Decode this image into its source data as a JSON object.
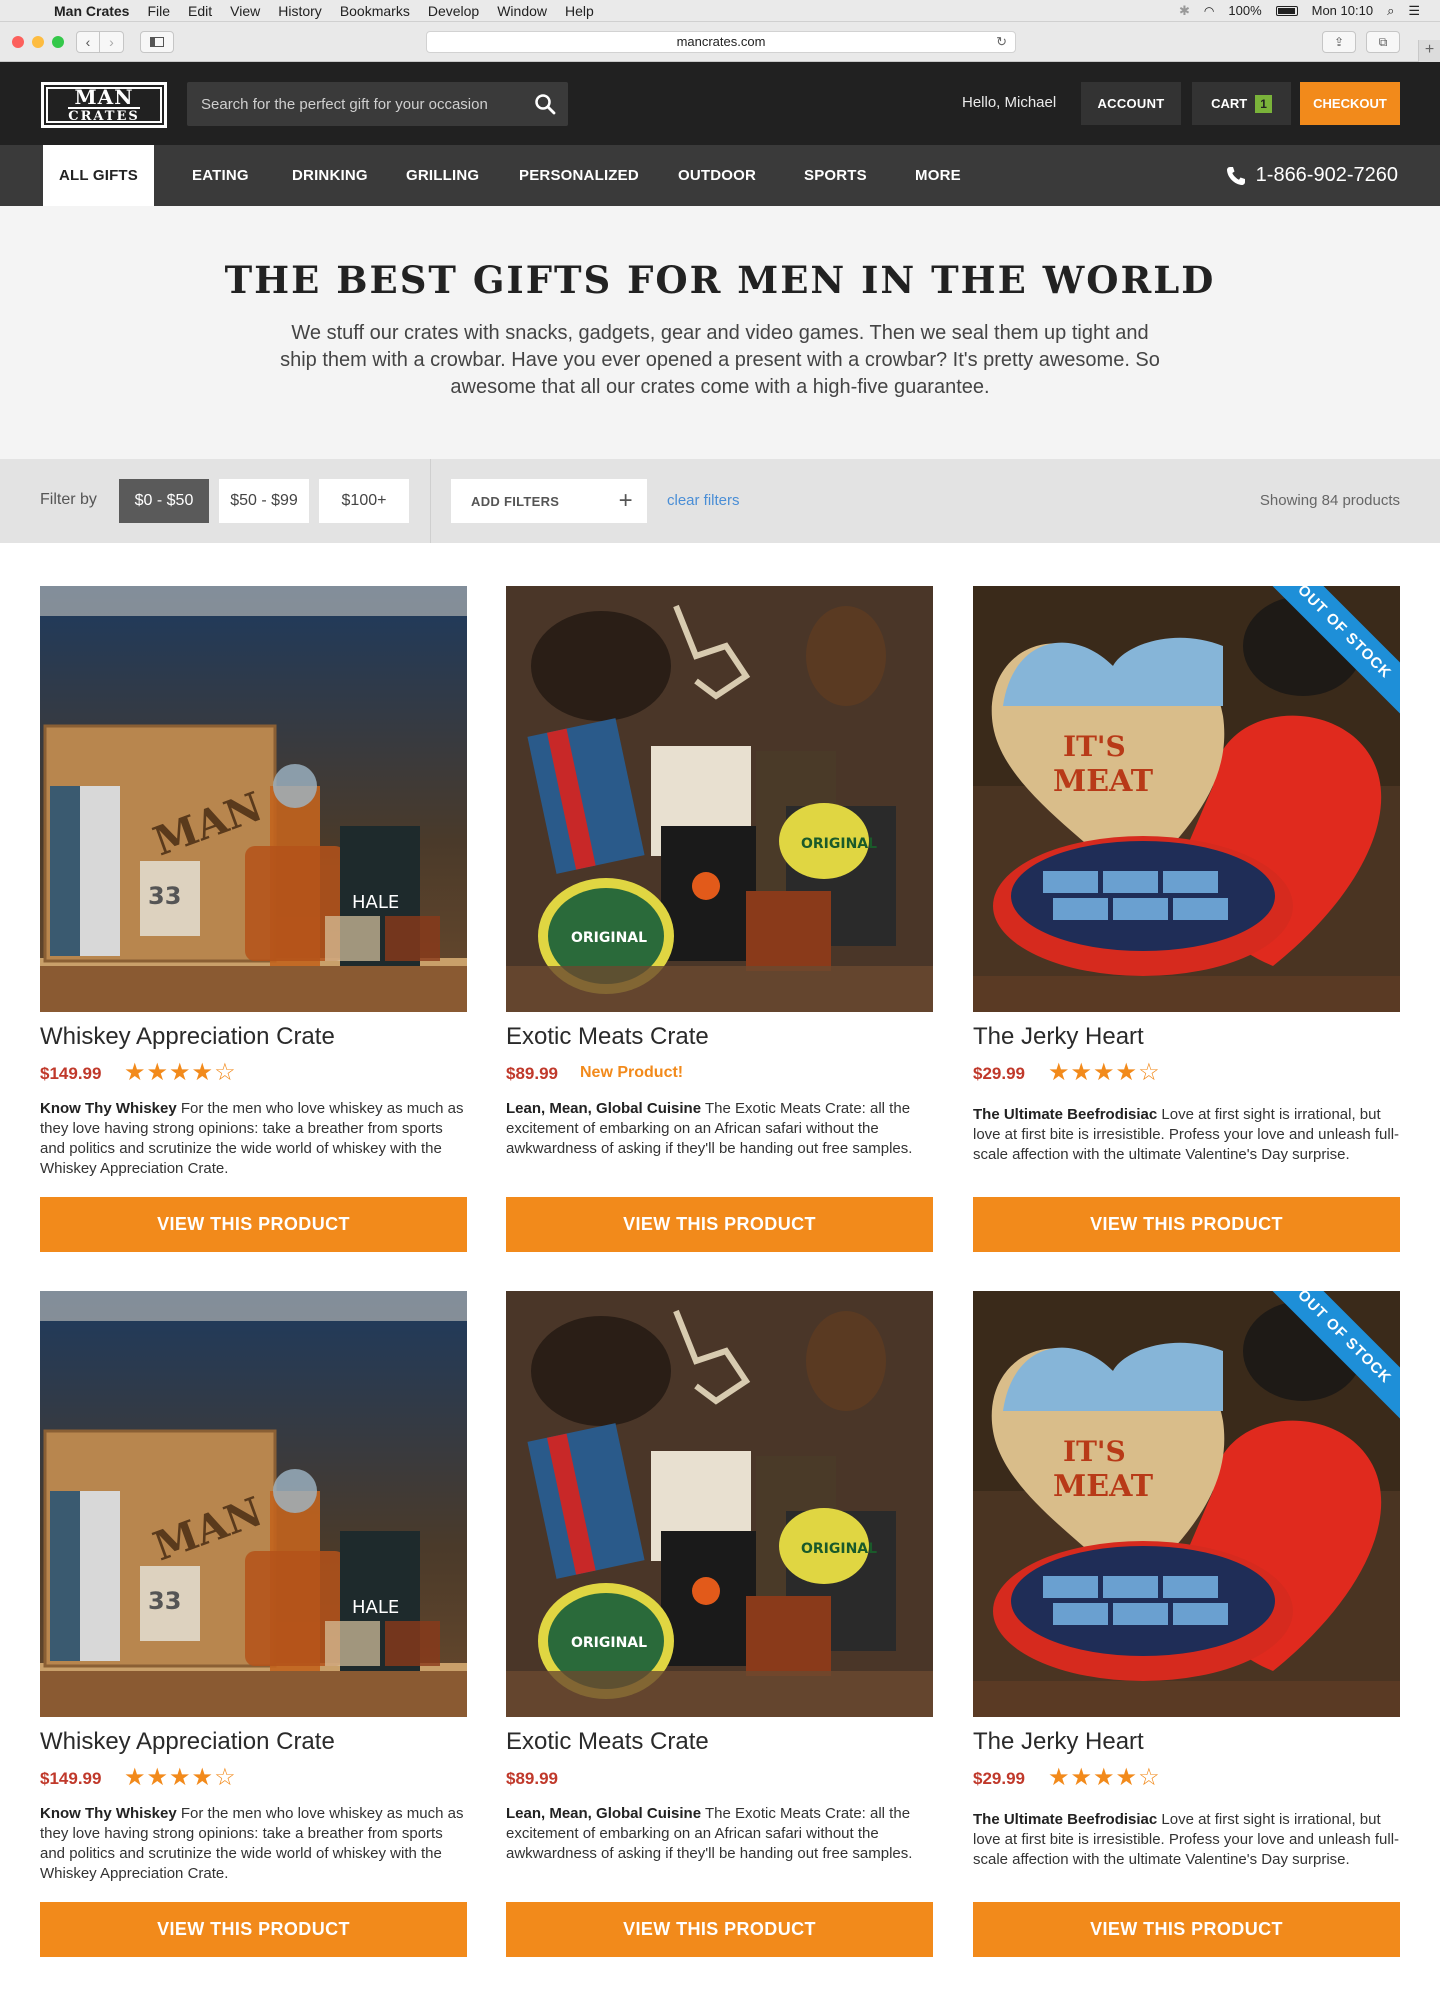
{
  "menubar": {
    "app": "Man Crates",
    "items": [
      "File",
      "Edit",
      "View",
      "History",
      "Bookmarks",
      "Develop",
      "Window",
      "Help"
    ],
    "battery": "100%",
    "clock": "Mon 10:10"
  },
  "browser": {
    "url": "mancrates.com"
  },
  "header": {
    "logo_line1": "MAN",
    "logo_line2": "CRATES",
    "search_placeholder": "Search for the perfect gift for your occasion",
    "greeting": "Hello, Michael",
    "account_label": "ACCOUNT",
    "cart_label": "CART",
    "cart_count": "1",
    "checkout_label": "CHECKOUT"
  },
  "nav": {
    "items": [
      "ALL GIFTS",
      "EATING",
      "DRINKING",
      "GRILLING",
      "PERSONALIZED",
      "OUTDOOR",
      "SPORTS",
      "MORE"
    ],
    "phone": "1-866-902-7260"
  },
  "hero": {
    "title": "THE BEST GIFTS FOR MEN IN THE WORLD",
    "text": "We stuff our crates with snacks, gadgets, gear and video games. Then we seal them up tight and ship them with a crowbar. Have you ever opened a present with a crowbar? It's pretty awesome. So awesome that all our crates come with a high-five guarantee."
  },
  "filters": {
    "label": "Filter by",
    "price_options": [
      "$0 - $50",
      "$50 - $99",
      "$100+"
    ],
    "selected": "$0 - $50",
    "add_filters": "ADD FILTERS",
    "clear": "clear filters",
    "showing": "Showing 84 products"
  },
  "colors": {
    "accent": "#f28a1b",
    "header_bg": "#212121",
    "nav_bg": "#3a3a3a",
    "price": "#c0392b",
    "oos_ribbon": "#1e8fd8"
  },
  "products": [
    {
      "name": "Whiskey Appreciation Crate",
      "price": "$149.99",
      "rating": 4,
      "badge": "",
      "desc_title": "Know Thy Whiskey",
      "desc": "For the men who love whiskey as much as they love having strong opinions: take a breather from sports and politics and scrutinize the wide world of whiskey with the Whiskey Appreciation Crate.",
      "button": "VIEW THIS PRODUCT",
      "out_of_stock": ""
    },
    {
      "name": "Exotic Meats Crate",
      "price": "$89.99",
      "rating": 0,
      "badge": "New Product!",
      "desc_title": "Lean, Mean, Global Cuisine",
      "desc": "The Exotic Meats Crate: all the excitement of embarking on an African safari without the awkwardness of asking if they'll be handing out free samples.",
      "button": "VIEW THIS PRODUCT",
      "out_of_stock": ""
    },
    {
      "name": "The Jerky Heart",
      "price": "$29.99",
      "rating": 4,
      "badge": "",
      "desc_title": "The Ultimate Beefrodisiac",
      "desc": "Love at first sight is irrational, but love at first bite is irresistible. Profess your love and unleash full-scale affection with the ultimate Valentine's Day surprise.",
      "button": "VIEW THIS PRODUCT",
      "out_of_stock": "OUT OF STOCK"
    },
    {
      "name": "Whiskey Appreciation Crate",
      "price": "$149.99",
      "rating": 4,
      "badge": "",
      "desc_title": "Know Thy Whiskey",
      "desc": "For the men who love whiskey as much as they love having strong opinions: take a breather from sports and politics and scrutinize the wide world of whiskey with the Whiskey Appreciation Crate.",
      "button": "VIEW THIS PRODUCT",
      "out_of_stock": ""
    },
    {
      "name": "Exotic Meats Crate",
      "price": "$89.99",
      "rating": 0,
      "badge": "",
      "desc_title": "Lean, Mean, Global Cuisine",
      "desc": "The Exotic Meats Crate: all the excitement of embarking on an African safari without the awkwardness of asking if they'll be handing out free samples.",
      "button": "VIEW THIS PRODUCT",
      "out_of_stock": ""
    },
    {
      "name": "The Jerky Heart",
      "price": "$29.99",
      "rating": 4,
      "badge": "",
      "desc_title": "The Ultimate Beefrodisiac",
      "desc": "Love at first sight is irrational, but love at first bite is irresistible. Profess your love and unleash full-scale affection with the ultimate Valentine's Day surprise.",
      "button": "VIEW THIS PRODUCT",
      "out_of_stock": "OUT OF STOCK"
    }
  ]
}
